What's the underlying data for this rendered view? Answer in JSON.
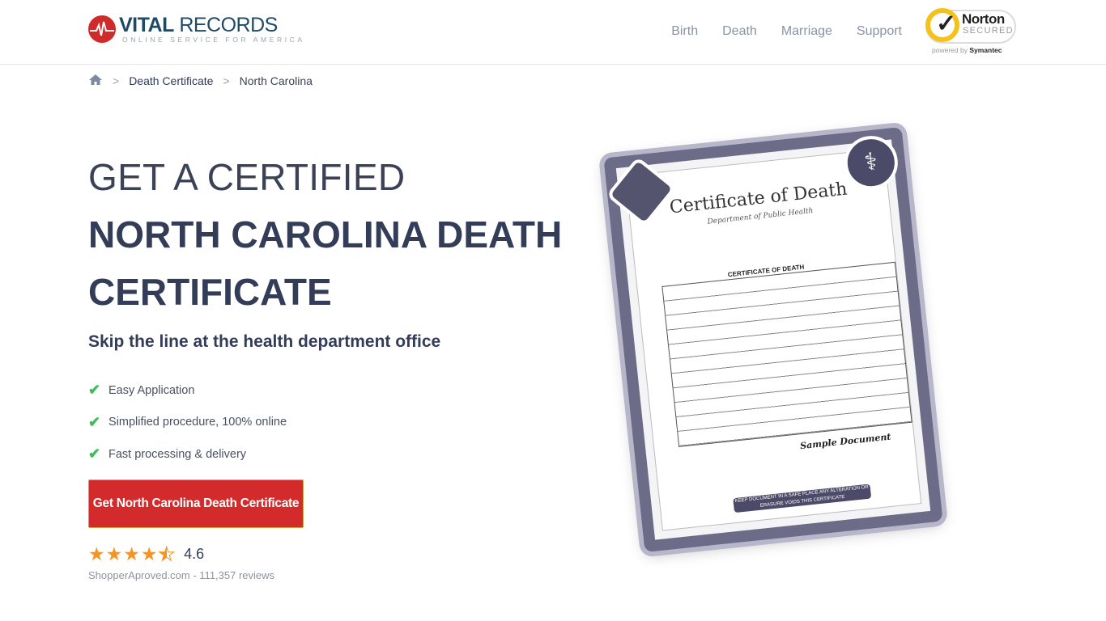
{
  "header": {
    "logo": {
      "bold": "VITAL",
      "light": " RECORDS",
      "tagline": "ONLINE SERVICE FOR AMERICA"
    },
    "nav": [
      "Birth",
      "Death",
      "Marriage",
      "Support"
    ],
    "norton": {
      "name": "Norton",
      "secured": "SECURED",
      "powered_by": "powered by",
      "brand": "Symantec"
    }
  },
  "breadcrumb": {
    "items": [
      "Death Certificate",
      "North Carolina"
    ]
  },
  "hero": {
    "title_line1": "GET A CERTIFIED",
    "title_line2": "NORTH CAROLINA DEATH",
    "title_line3": "CERTIFICATE",
    "subtitle": "Skip the line at the health department office",
    "features": [
      "Easy Application",
      "Simplified procedure, 100% online",
      "Fast processing & delivery"
    ],
    "cta_label": "Get North Carolina Death Certificate",
    "rating": {
      "value": "4.6",
      "stars": 4.6,
      "reviews": "ShopperAproved.com - 111,357 reviews"
    }
  },
  "certificate": {
    "title": "Certificate of Death",
    "department": "Department of Public Health",
    "form_title": "CERTIFICATE OF DEATH",
    "sample": "Sample Document",
    "footer": "KEEP DOCUMENT IN A SAFE PLACE ANY ALTERATION OR ERASURE VOIDS THIS CERTIFICATE"
  },
  "colors": {
    "accent": "#d32b2b",
    "check": "#3bbf58",
    "star": "#f7931e",
    "heading": "#333d58"
  }
}
